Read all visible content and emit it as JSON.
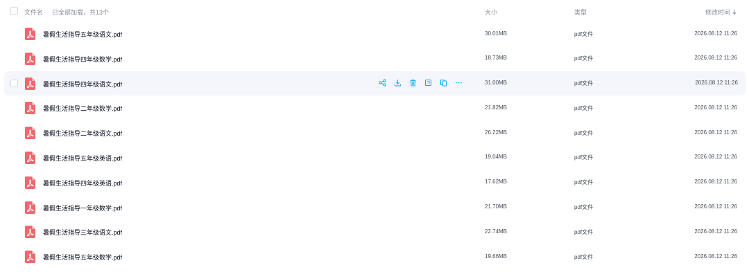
{
  "header": {
    "name_label": "文件名",
    "loaded_text": "已全部加载，共13个",
    "size_label": "大小",
    "type_label": "类型",
    "time_label": "修改时间"
  },
  "colors": {
    "pdf_icon": "#f0676f",
    "accent": "#06a7ff",
    "hover_row": "#f4f6fb"
  },
  "files": [
    {
      "name": "暑假生活指导五年级语文.pdf",
      "size": "30.01MB",
      "type": "pdf文件",
      "modified": "2026.08.12 11:26"
    },
    {
      "name": "暑假生活指导四年级数学.pdf",
      "size": "18.73MB",
      "type": "pdf文件",
      "modified": "2026.08.12 11:26"
    },
    {
      "name": "暑假生活指导四年级语文.pdf",
      "size": "31.00MB",
      "type": "pdf文件",
      "modified": "2026.08.12 11:26"
    },
    {
      "name": "暑假生活指导二年级数学.pdf",
      "size": "21.82MB",
      "type": "pdf文件",
      "modified": "2026.08.12 11:26"
    },
    {
      "name": "暑假生活指导二年级语文.pdf",
      "size": "26.22MB",
      "type": "pdf文件",
      "modified": "2026.08.12 11:26"
    },
    {
      "name": "暑假生活指导五年级英语.pdf",
      "size": "19.04MB",
      "type": "pdf文件",
      "modified": "2026.08.12 11:26"
    },
    {
      "name": "暑假生活指导四年级英语.pdf",
      "size": "17.62MB",
      "type": "pdf文件",
      "modified": "2026.08.12 11:26"
    },
    {
      "name": "暑假生活指导一年级数学.pdf",
      "size": "21.70MB",
      "type": "pdf文件",
      "modified": "2026.08.12 11:26"
    },
    {
      "name": "暑假生活指导三年级语文.pdf",
      "size": "22.74MB",
      "type": "pdf文件",
      "modified": "2026.08.12 11:26"
    },
    {
      "name": "暑假生活指导五年级数学.pdf",
      "size": "19.66MB",
      "type": "pdf文件",
      "modified": "2026.08.12 11:26"
    }
  ],
  "hover_row_actions": [
    "share-icon",
    "download-icon",
    "delete-icon",
    "copy-icon",
    "move-icon",
    "more-icon"
  ]
}
